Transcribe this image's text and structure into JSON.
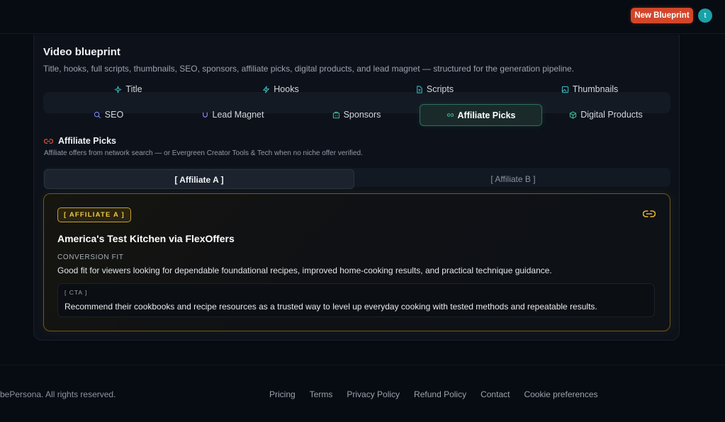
{
  "header": {
    "new_blueprint_label": "New Blueprint",
    "avatar_initial": "t"
  },
  "blueprint": {
    "title": "Video blueprint",
    "subtitle": "Title, hooks, full scripts, thumbnails, SEO, sponsors, affiliate picks, digital products, and lead magnet — structured for the generation pipeline.",
    "tabs_row1": [
      {
        "label": "Title",
        "icon": "sparkles-icon"
      },
      {
        "label": "Hooks",
        "icon": "zap-icon"
      },
      {
        "label": "Scripts",
        "icon": "file-text-icon"
      },
      {
        "label": "Thumbnails",
        "icon": "image-icon"
      }
    ],
    "tabs_row2": [
      {
        "label": "SEO",
        "icon": "search-icon"
      },
      {
        "label": "Lead Magnet",
        "icon": "magnet-icon"
      },
      {
        "label": "Sponsors",
        "icon": "building-icon"
      },
      {
        "label": "Affiliate Picks",
        "icon": "link-icon",
        "active": true
      },
      {
        "label": "Digital Products",
        "icon": "package-icon"
      }
    ]
  },
  "section": {
    "title": "Affiliate Picks",
    "description": "Affiliate offers from network search — or Evergreen Creator Tools & Tech when no niche offer verified."
  },
  "affiliate_tabs": [
    "[ Affiliate A ]",
    "[ Affiliate B ]"
  ],
  "affiliate_card": {
    "badge": "[ AFFILIATE A ]",
    "title": "America's Test Kitchen via FlexOffers",
    "conversion_label": "CONVERSION FIT",
    "conversion_text": "Good fit for viewers looking for dependable foundational recipes, improved home-cooking results, and practical technique guidance.",
    "cta_label": "[ CTA ]",
    "cta_text": "Recommend their cookbooks and recipe resources as a trusted way to level up everyday cooking with tested methods and repeatable results."
  },
  "footer": {
    "copyright": "bePersona. All rights reserved.",
    "links": [
      "Pricing",
      "Terms",
      "Privacy Policy",
      "Refund Policy",
      "Contact",
      "Cookie preferences"
    ]
  },
  "colors": {
    "accent_orange": "#d2462a",
    "accent_teal": "#17a2a8",
    "affiliate_gold": "#f0c843",
    "active_tab_border": "#2f6f61"
  }
}
